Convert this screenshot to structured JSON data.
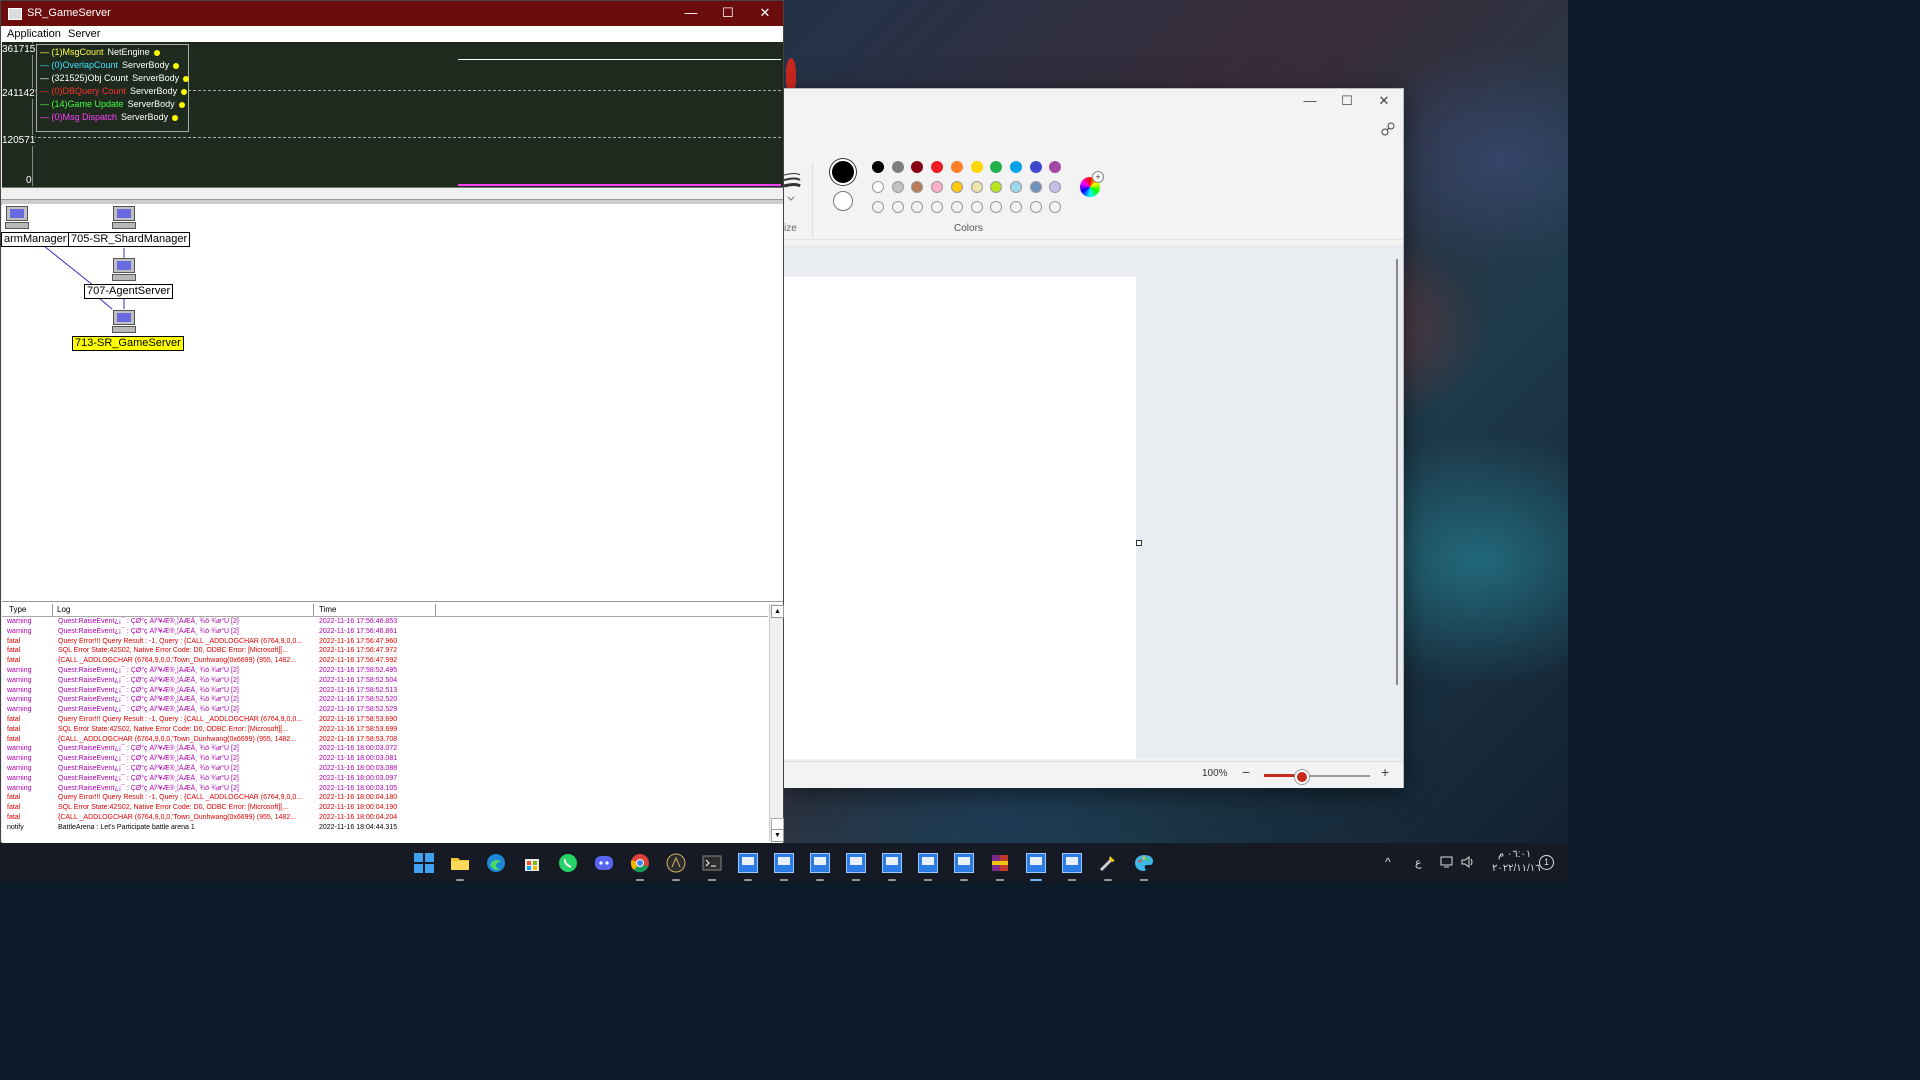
{
  "server_window": {
    "title": "SR_GameServer",
    "controls": {
      "minimize": "—",
      "maximize": "☐",
      "close": "✕"
    },
    "menu": [
      "Application",
      "Server"
    ],
    "graph": {
      "y_ticks": [
        "361715",
        "241142",
        "120571",
        "0"
      ],
      "legend": [
        {
          "label": "(1)MsgCount",
          "source": "NetEngine",
          "color": "#ffff40"
        },
        {
          "label": "(0)OverlapCount",
          "source": "ServerBody",
          "color": "#40e0ff"
        },
        {
          "label": "(321525)Obj Count",
          "source": "ServerBody",
          "color": "#ffffff"
        },
        {
          "label": "(0)DBQuery Count",
          "source": "ServerBody",
          "color": "#ff3030"
        },
        {
          "label": "(14)Game Update",
          "source": "ServerBody",
          "color": "#40ff40"
        },
        {
          "label": "(0)Msg Dispatch",
          "source": "ServerBody",
          "color": "#ff40ff"
        }
      ]
    },
    "topology": {
      "nodes": [
        "armManager",
        "705-SR_ShardManager",
        "707-AgentServer",
        "713-SR_GameServer"
      ]
    },
    "log": {
      "columns": [
        "Type",
        "Log",
        "Time"
      ],
      "rows": [
        {
          "type": "warning",
          "log": "Quest:RaiseEvent¿¡¯ : ÇØ°ç ÀÌº¥Æ®¸¦ÀÆÄ¸ ¾ö ¾ø°Ú [2]",
          "time": "2022-11-16 17:56:46.853",
          "color": "#b000b0"
        },
        {
          "type": "warning",
          "log": "Quest:RaiseEvent¿¡¯ : ÇØ°ç ÀÌº¥Æ®¸¦ÀÆÄ¸ ¾ö ¾ø°Ú [2]",
          "time": "2022-11-16 17:56:46.861",
          "color": "#b000b0"
        },
        {
          "type": "fatal",
          "log": "Query Error!!! Query Result : -1, Query : {CALL _ADDLOGCHAR (6764,9,0,0...",
          "time": "2022-11-16 17:56:47.960",
          "color": "#e00000"
        },
        {
          "type": "fatal",
          "log": "SQL Error State:42S02, Native Error Code: D0, ODBC Error: [Microsoft][...",
          "time": "2022-11-16 17:56:47.972",
          "color": "#e00000"
        },
        {
          "type": "fatal",
          "log": "{CALL _ADDLOGCHAR (6764,9,0,0,'Town_Dunhwang(0x6699) (955, 1482...",
          "time": "2022-11-16 17:56:47.992",
          "color": "#e00000"
        },
        {
          "type": "warning",
          "log": "Quest:RaiseEvent¿¡¯ : ÇØ°ç ÀÌº¥Æ®¸¦ÀÆÄ¸ ¾ö ¾ø°Ú [2]",
          "time": "2022-11-16 17:58:52.495",
          "color": "#b000b0"
        },
        {
          "type": "warning",
          "log": "Quest:RaiseEvent¿¡¯ : ÇØ°ç ÀÌº¥Æ®¸¦ÀÆÄ¸ ¾ö ¾ø°Ú [2]",
          "time": "2022-11-16 17:58:52.504",
          "color": "#b000b0"
        },
        {
          "type": "warning",
          "log": "Quest:RaiseEvent¿¡¯ : ÇØ°ç ÀÌº¥Æ®¸¦ÀÆÄ¸ ¾ö ¾ø°Ú [2]",
          "time": "2022-11-16 17:58:52.513",
          "color": "#b000b0"
        },
        {
          "type": "warning",
          "log": "Quest:RaiseEvent¿¡¯ : ÇØ°ç ÀÌº¥Æ®¸¦ÀÆÄ¸ ¾ö ¾ø°Ú [2]",
          "time": "2022-11-16 17:58:52.520",
          "color": "#b000b0"
        },
        {
          "type": "warning",
          "log": "Quest:RaiseEvent¿¡¯ : ÇØ°ç ÀÌº¥Æ®¸¦ÀÆÄ¸ ¾ö ¾ø°Ú [2]",
          "time": "2022-11-16 17:58:52.529",
          "color": "#b000b0"
        },
        {
          "type": "fatal",
          "log": "Query Error!!! Query Result : -1, Query : {CALL _ADDLOGCHAR (6764,9,0,0...",
          "time": "2022-11-16 17:58:53.690",
          "color": "#e00000"
        },
        {
          "type": "fatal",
          "log": "SQL Error State:42S02, Native Error Code: D0, ODBC Error: [Microsoft][...",
          "time": "2022-11-16 17:58:53.699",
          "color": "#e00000"
        },
        {
          "type": "fatal",
          "log": "{CALL _ADDLOGCHAR (6764,9,0,0,'Town_Dunhwang(0x6699) (955, 1482...",
          "time": "2022-11-16 17:58:53.708",
          "color": "#e00000"
        },
        {
          "type": "warning",
          "log": "Quest:RaiseEvent¿¡¯ : ÇØ°ç ÀÌº¥Æ®¸¦ÀÆÄ¸ ¾ö ¾ø°Ú [2]",
          "time": "2022-11-16 18:00:03.072",
          "color": "#b000b0"
        },
        {
          "type": "warning",
          "log": "Quest:RaiseEvent¿¡¯ : ÇØ°ç ÀÌº¥Æ®¸¦ÀÆÄ¸ ¾ö ¾ø°Ú [2]",
          "time": "2022-11-16 18:00:03.081",
          "color": "#b000b0"
        },
        {
          "type": "warning",
          "log": "Quest:RaiseEvent¿¡¯ : ÇØ°ç ÀÌº¥Æ®¸¦ÀÆÄ¸ ¾ö ¾ø°Ú [2]",
          "time": "2022-11-16 18:00:03.088",
          "color": "#b000b0"
        },
        {
          "type": "warning",
          "log": "Quest:RaiseEvent¿¡¯ : ÇØ°ç ÀÌº¥Æ®¸¦ÀÆÄ¸ ¾ö ¾ø°Ú [2]",
          "time": "2022-11-16 18:00:03.097",
          "color": "#b000b0"
        },
        {
          "type": "warning",
          "log": "Quest:RaiseEvent¿¡¯ : ÇØ°ç ÀÌº¥Æ®¸¦ÀÆÄ¸ ¾ö ¾ø°Ú [2]",
          "time": "2022-11-16 18:00:03.105",
          "color": "#b000b0"
        },
        {
          "type": "fatal",
          "log": "Query Error!!! Query Result : -1, Query : {CALL _ADDLOGCHAR (6764,9,0,0...",
          "time": "2022-11-16 18:00:04.180",
          "color": "#e00000"
        },
        {
          "type": "fatal",
          "log": "SQL Error State:42S02, Native Error Code: D0, ODBC Error: [Microsoft][...",
          "time": "2022-11-16 18:00:04.190",
          "color": "#e00000"
        },
        {
          "type": "fatal",
          "log": "{CALL _ADDLOGCHAR (6764,9,0,0,'Town_Dunhwang(0x6699) (955, 1482...",
          "time": "2022-11-16 18:00:04.204",
          "color": "#e00000"
        },
        {
          "type": "notify",
          "log": "BattleArena : Let's Participate battle arena 1",
          "time": "2022-11-16 18:04:44.315",
          "color": "#000000"
        }
      ]
    }
  },
  "paint_window": {
    "controls": {
      "minimize": "—",
      "maximize": "☐",
      "close": "✕"
    },
    "size_label": "ize",
    "colors_label": "Colors",
    "color1": "#000000",
    "color2": "#ffffff",
    "palette_row1": [
      "#000000",
      "#7f7f7f",
      "#880015",
      "#ed1c24",
      "#ff7f27",
      "#ffd700",
      "#22b14c",
      "#00a2e8",
      "#3f48cc",
      "#a349a4"
    ],
    "palette_row2": [
      "#ffffff",
      "#c3c3c3",
      "#b97a57",
      "#ffaec9",
      "#ffc90e",
      "#efe4b0",
      "#b5e61d",
      "#99d9ea",
      "#7092be",
      "#c8bfe7"
    ],
    "custom_slots": 10,
    "zoom": "100%",
    "zoom_fraction": 0.35
  },
  "taskbar": {
    "apps": [
      "start",
      "file-explorer",
      "edge",
      "store",
      "whatsapp",
      "discord",
      "chrome",
      "game-launcher",
      "terminal",
      "app-window-1",
      "app-window-2",
      "app-window-3",
      "app-window-4",
      "app-window-5",
      "app-window-6",
      "app-window-7",
      "winrar",
      "app-window-8",
      "app-window-9",
      "tools",
      "paint"
    ],
    "tray": {
      "chevron": "^",
      "ime": "ع",
      "time": "٠٦:٠١ م",
      "date": "٢٠٢٢/١١/١٦",
      "notifications": "1"
    }
  }
}
